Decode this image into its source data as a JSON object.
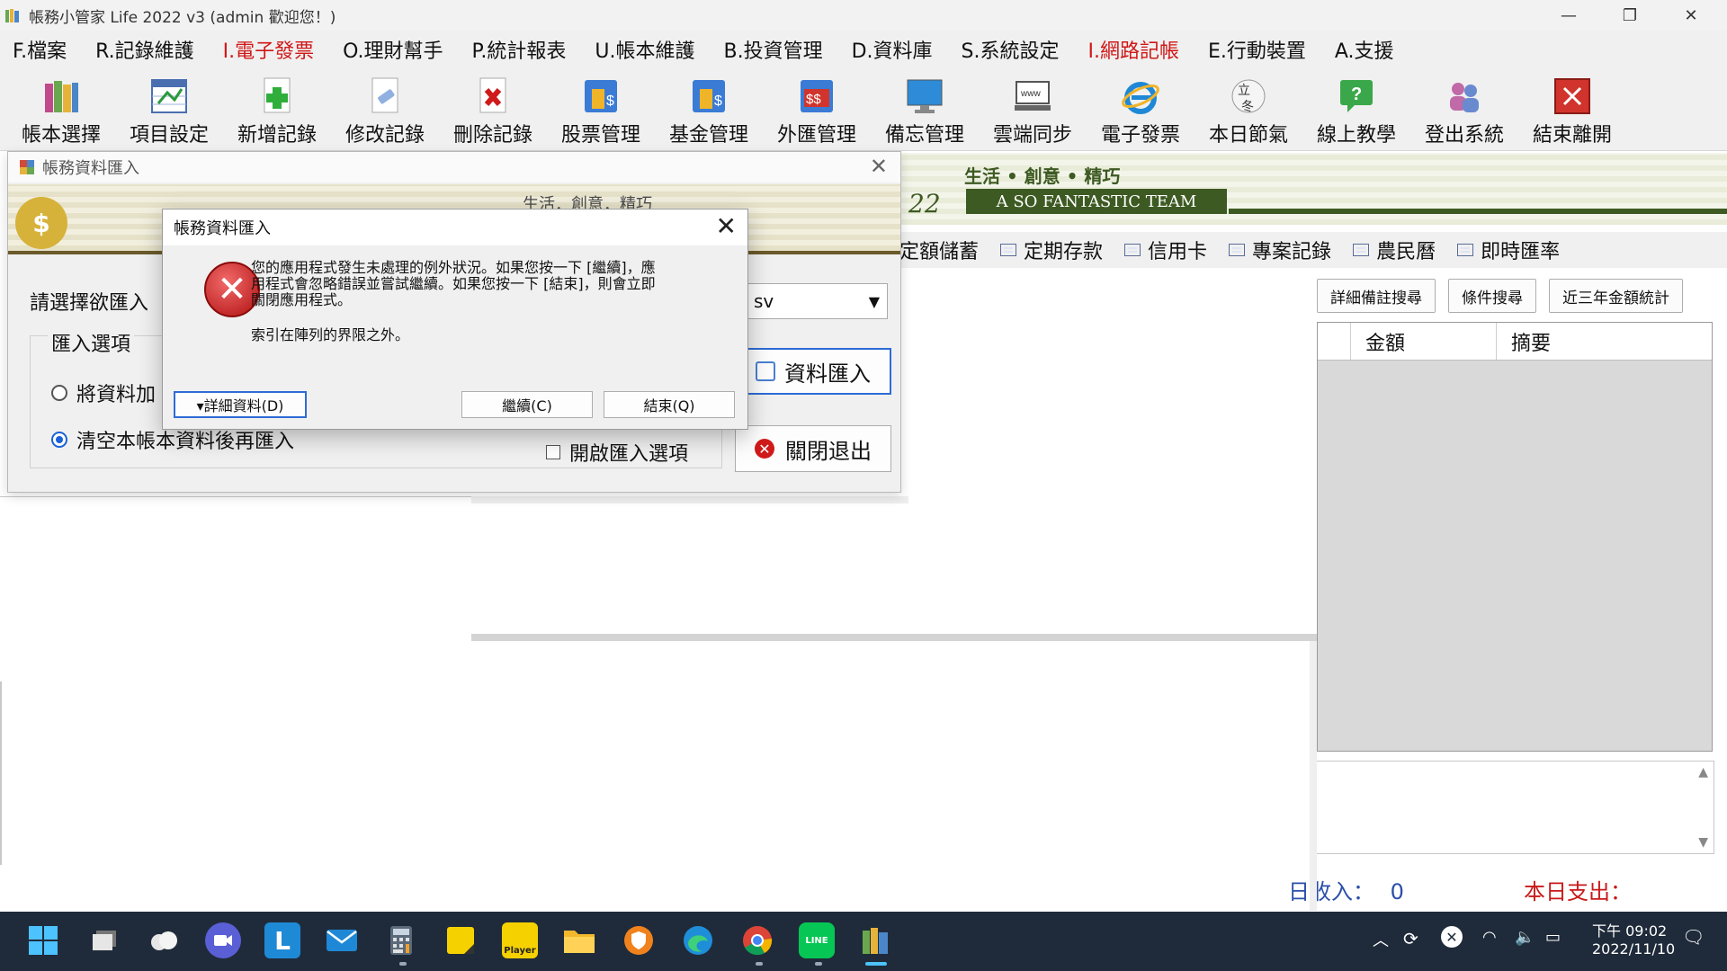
{
  "window": {
    "title": "帳務小管家 Life 2022 v3 (admin 歡迎您！)"
  },
  "menu": [
    {
      "label": "F.檔案",
      "red": false
    },
    {
      "label": "R.記錄維護",
      "red": false
    },
    {
      "label": "I.電子發票",
      "red": true
    },
    {
      "label": "O.理財幫手",
      "red": false
    },
    {
      "label": "P.統計報表",
      "red": false
    },
    {
      "label": "U.帳本維護",
      "red": false
    },
    {
      "label": "B.投資管理",
      "red": false
    },
    {
      "label": "D.資料庫",
      "red": false
    },
    {
      "label": "S.系統設定",
      "red": false
    },
    {
      "label": "I.網路記帳",
      "red": true
    },
    {
      "label": "E.行動裝置",
      "red": false
    },
    {
      "label": "A.支援",
      "red": false
    }
  ],
  "toolbar": [
    {
      "label": "帳本選擇",
      "icon": "books-icon"
    },
    {
      "label": "項目設定",
      "icon": "spreadsheet-icon"
    },
    {
      "label": "新增記錄",
      "icon": "add-record-icon"
    },
    {
      "label": "修改記錄",
      "icon": "edit-record-icon"
    },
    {
      "label": "刪除記錄",
      "icon": "delete-record-icon"
    },
    {
      "label": "股票管理",
      "icon": "stock-icon"
    },
    {
      "label": "基金管理",
      "icon": "fund-icon"
    },
    {
      "label": "外匯管理",
      "icon": "forex-icon"
    },
    {
      "label": "備忘管理",
      "icon": "monitor-icon"
    },
    {
      "label": "雲端同步",
      "icon": "cloud-sync-icon"
    },
    {
      "label": "電子發票",
      "icon": "ie-icon"
    },
    {
      "label": "本日節氣",
      "icon": "solar-term-icon"
    },
    {
      "label": "線上教學",
      "icon": "help-icon"
    },
    {
      "label": "登出系統",
      "icon": "logout-icon"
    },
    {
      "label": "結束離開",
      "icon": "exit-icon"
    }
  ],
  "banner": {
    "slogan": "生活 • 創意 • 精巧",
    "year_fragment": "22",
    "team": "A SO FANTASTIC TEAM"
  },
  "tabs": [
    "定額儲蓄",
    "定期存款",
    "信用卡",
    "專案記錄",
    "農民曆",
    "即時匯率"
  ],
  "search_buttons": [
    "詳細備註搜尋",
    "條件搜尋",
    "近三年金額統計"
  ],
  "grid": {
    "columns": [
      "金額",
      "摘要"
    ]
  },
  "status": {
    "income_label": "日收入：",
    "income_value": "0",
    "expense_label": "本日支出："
  },
  "import_dialog": {
    "title": "帳務資料匯入",
    "banner_text": "生活．創意．精巧",
    "select_label": "請選擇欲匯入",
    "combo_value": "sv",
    "group_title": "匯入選項",
    "option1": "將資料加",
    "option2": "清空本帳本資料後再匯入",
    "open_options_label": "開啟匯入選項",
    "import_button": "資料匯入",
    "close_button": "關閉退出"
  },
  "error_dialog": {
    "title": "帳務資料匯入",
    "message_line1": "您的應用程式發生未處理的例外狀況。如果您按一下 [繼續]，應",
    "message_line2": "用程式會忽略錯誤並嘗試繼續。如果您按一下 [結束]，則會立即",
    "message_line3": "關閉應用程式。",
    "index_error": "索引在陣列的界限之外。",
    "details_button": "▾詳細資料(D)",
    "continue_button": "繼續(C)",
    "quit_button": "結束(Q)"
  },
  "taskbar": {
    "time": "下午 09:02",
    "date": "2022/11/10",
    "line_badge": "LINE",
    "player_label": "Player",
    "l_label": "L"
  }
}
